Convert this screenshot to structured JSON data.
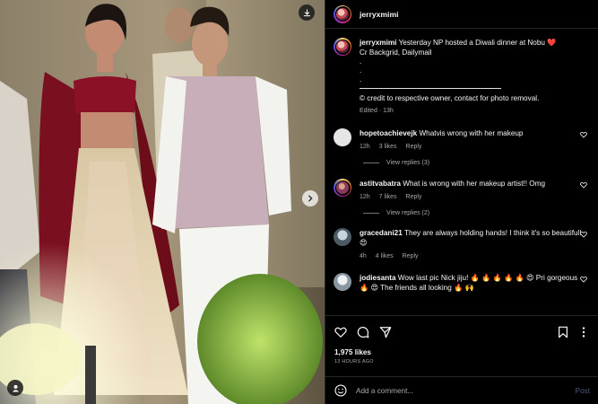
{
  "post": {
    "author": "jerryxmimi",
    "caption": {
      "username": "jerryxmimi",
      "line1": "Yesterday NP hosted a Diwali dinner at Nobu",
      "heart_emoji": "❤️",
      "line2": "Cr Backgrid, Dailymail",
      "dots": [
        ".",
        ".",
        "."
      ],
      "credit": "© credit to respective owner, contact for photo removal.",
      "meta": "Edited · 13h"
    },
    "comments": [
      {
        "username": "hopetoachievejk",
        "text": "Whatvis wrong with her makeup",
        "time": "12h",
        "likes": "3 likes",
        "reply": "Reply",
        "view_replies": "View replies (3)",
        "avatar_color": "#e6e6e6"
      },
      {
        "username": "astitvabatra",
        "text": "What is wrong with her makeup artist!! Omg",
        "time": "12h",
        "likes": "7 likes",
        "reply": "Reply",
        "view_replies": "View replies (2)",
        "avatar_color": "#8a3a5a"
      },
      {
        "username": "gracedani21",
        "text": "They are always holding hands! I think it's so beautiful!",
        "emoji": "😍",
        "time": "4h",
        "likes": "4 likes",
        "reply": "Reply",
        "avatar_color": "#7a8b99"
      },
      {
        "username": "jodiesanta",
        "text": "Wow last pic Nick jiju!",
        "emoji_row": "🔥 🔥 🔥 🔥 🔥 😍",
        "text2": "Pri gorgeous",
        "emoji2": "🔥 😍",
        "text3": "The friends all looking",
        "emoji3": "🔥 🙌",
        "avatar_color": "#b9c4cc"
      }
    ],
    "likes": "1,975 likes",
    "time_ago": "13 HOURS AGO",
    "add_comment_placeholder": "Add a comment...",
    "post_label": "Post"
  },
  "icons": {
    "download": "download-icon",
    "next": "chevron-right-icon",
    "tagged": "user-icon",
    "like": "heart-icon",
    "comment": "comment-icon",
    "share": "send-icon",
    "save": "bookmark-icon",
    "more": "more-icon",
    "emoji": "emoji-icon"
  },
  "colors": {
    "background": "#000000",
    "divider": "#262626",
    "muted_text": "#a8a8a8",
    "post_button_disabled": "#4c5a7a"
  }
}
